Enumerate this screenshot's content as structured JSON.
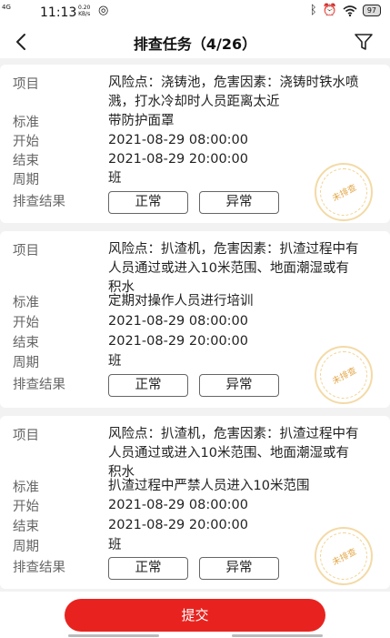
{
  "status_bar": {
    "network": "4G",
    "time": "11:13",
    "speed_value": "0.20",
    "speed_unit": "KB/s",
    "battery": "97"
  },
  "header": {
    "title": "排查任务（4/26）"
  },
  "labels": {
    "item": "项目",
    "standard": "标准",
    "start": "开始",
    "end": "结束",
    "period": "周期",
    "result": "排查结果"
  },
  "buttons": {
    "normal": "正常",
    "abnormal": "异常",
    "submit": "提交"
  },
  "tasks": [
    {
      "item": "风险点：浇铸池，危害因素：浇铸时铁水喷溅，打水冷却时人员距离太近",
      "standard": "带防护面罩",
      "start": "2021-08-29 08:00:00",
      "end": "2021-08-29 20:00:00",
      "period": "班",
      "stamp": "未排查"
    },
    {
      "item": "风险点：扒渣机，危害因素：扒渣过程中有人员通过或进入10米范围、地面潮湿或有积水",
      "standard": "定期对操作人员进行培训",
      "start": "2021-08-29 08:00:00",
      "end": "2021-08-29 20:00:00",
      "period": "班",
      "stamp": "未排查"
    },
    {
      "item": "风险点：扒渣机，危害因素：扒渣过程中有人员通过或进入10米范围、地面潮湿或有积水",
      "standard": "扒渣过程中严禁人员进入10米范围",
      "start": "2021-08-29 08:00:00",
      "end": "2021-08-29 20:00:00",
      "period": "班",
      "stamp": "未排查"
    }
  ],
  "colors": {
    "accent": "#e8231f",
    "stamp": "#e8b64e"
  },
  "icons": [
    "back-arrow-icon",
    "filter-icon",
    "bluetooth-icon",
    "alarm-icon",
    "wifi-icon",
    "battery-icon"
  ]
}
